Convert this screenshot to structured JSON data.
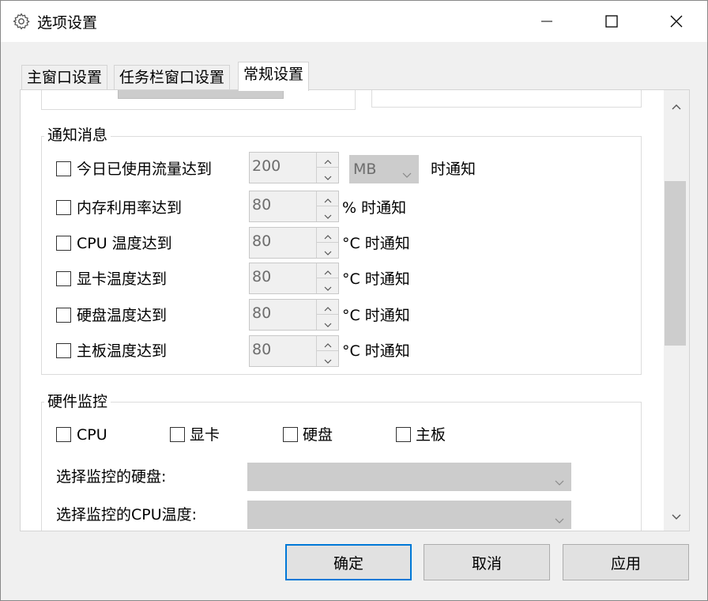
{
  "window": {
    "title": "选项设置",
    "icon": "gear-icon"
  },
  "titlebar_buttons": {
    "minimize": "minimize-icon",
    "maximize": "maximize-icon",
    "close": "close-icon"
  },
  "tabs": [
    {
      "label": "主窗口设置",
      "active": false
    },
    {
      "label": "任务栏窗口设置",
      "active": false
    },
    {
      "label": "常规设置",
      "active": true
    }
  ],
  "notify": {
    "title": "通知消息",
    "items": [
      {
        "label": "今日已使用流量达到",
        "checked": false,
        "value": "200",
        "unit_select": "MB",
        "suffix": "时通知"
      },
      {
        "label": "内存利用率达到",
        "checked": false,
        "value": "80",
        "suffix": "% 时通知"
      },
      {
        "label": "CPU 温度达到",
        "checked": false,
        "value": "80",
        "suffix": "°C 时通知"
      },
      {
        "label": "显卡温度达到",
        "checked": false,
        "value": "80",
        "suffix": "°C 时通知"
      },
      {
        "label": "硬盘温度达到",
        "checked": false,
        "value": "80",
        "suffix": "°C 时通知"
      },
      {
        "label": "主板温度达到",
        "checked": false,
        "value": "80",
        "suffix": "°C 时通知"
      }
    ]
  },
  "hardware": {
    "title": "硬件监控",
    "checks": [
      {
        "label": "CPU",
        "checked": false
      },
      {
        "label": "显卡",
        "checked": false
      },
      {
        "label": "硬盘",
        "checked": false
      },
      {
        "label": "主板",
        "checked": false
      }
    ],
    "select_disk_label": "选择监控的硬盘:",
    "select_disk_value": "",
    "select_cpu_label": "选择监控的CPU温度:",
    "select_cpu_value": ""
  },
  "buttons": {
    "ok": "确定",
    "cancel": "取消",
    "apply": "应用"
  },
  "colors": {
    "accent": "#0078d7",
    "disabled_bg": "#cccccc"
  }
}
